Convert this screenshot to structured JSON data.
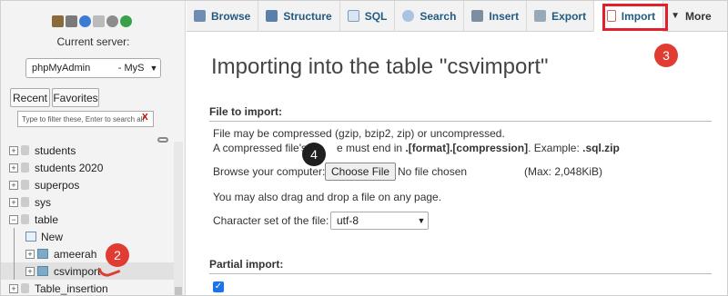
{
  "sidebar": {
    "icons": [
      "home-icon",
      "database-icon",
      "help-icon",
      "docs-icon",
      "settings-icon",
      "reload-icon"
    ],
    "current_server_label": "Current server:",
    "server_select_value": "phpMyAdmin          - MyS",
    "tabs": {
      "recent": "Recent",
      "favorites": "Favorites"
    },
    "filter_placeholder": "Type to filter these, Enter to search all",
    "filter_clear": "X",
    "tree": [
      {
        "label": "students",
        "type": "db",
        "expander": "+"
      },
      {
        "label": "students 2020",
        "type": "db",
        "expander": "+"
      },
      {
        "label": "superpos",
        "type": "db",
        "expander": "+"
      },
      {
        "label": "sys",
        "type": "db",
        "expander": "+"
      },
      {
        "label": "table",
        "type": "db",
        "expander": "−"
      },
      {
        "label": "New",
        "type": "new"
      },
      {
        "label": "ameerah",
        "type": "table",
        "expander": "+"
      },
      {
        "label": "csvimport",
        "type": "table",
        "expander": "+",
        "selected": true
      },
      {
        "label": "Table_insertion",
        "type": "db",
        "expander": "+"
      }
    ]
  },
  "topbar": {
    "tabs": [
      {
        "label": "Browse",
        "icon": "browse-icon"
      },
      {
        "label": "Structure",
        "icon": "structure-icon"
      },
      {
        "label": "SQL",
        "icon": "sql-icon"
      },
      {
        "label": "Search",
        "icon": "search-icon"
      },
      {
        "label": "Insert",
        "icon": "insert-icon"
      },
      {
        "label": "Export",
        "icon": "export-icon"
      },
      {
        "label": "Import",
        "icon": "import-icon",
        "active": true
      },
      {
        "label": "More",
        "icon": "chevron-down-icon"
      }
    ]
  },
  "main": {
    "title": "Importing into the table \"csvimport\"",
    "file_section": "File to import:",
    "compress_line": "File may be compressed (gzip, bzip2, zip) or uncompressed.",
    "compress_line2_pre": "A compressed file's",
    "compress_line2_mid": "e must end in",
    "compress_format": ".[format].[compression]",
    "compress_example_label": ". Example:",
    "compress_example": ".sql.zip",
    "browse_label": "Browse your computer:",
    "choose_file": "Choose File",
    "no_file": "No file chosen",
    "max_size": "(Max: 2,048KiB)",
    "drag_hint": "You may also drag and drop a file on any page.",
    "charset_label": "Character set of the file:",
    "charset_value": "utf-8",
    "partial_section": "Partial import:"
  },
  "annotations": {
    "step2": "2",
    "step3": "3",
    "step4": "4"
  },
  "colors": {
    "highlight": "#e0202b",
    "badge_red": "#e03c31",
    "badge_dark": "#1f1f1f",
    "link_blue": "#235a81"
  }
}
